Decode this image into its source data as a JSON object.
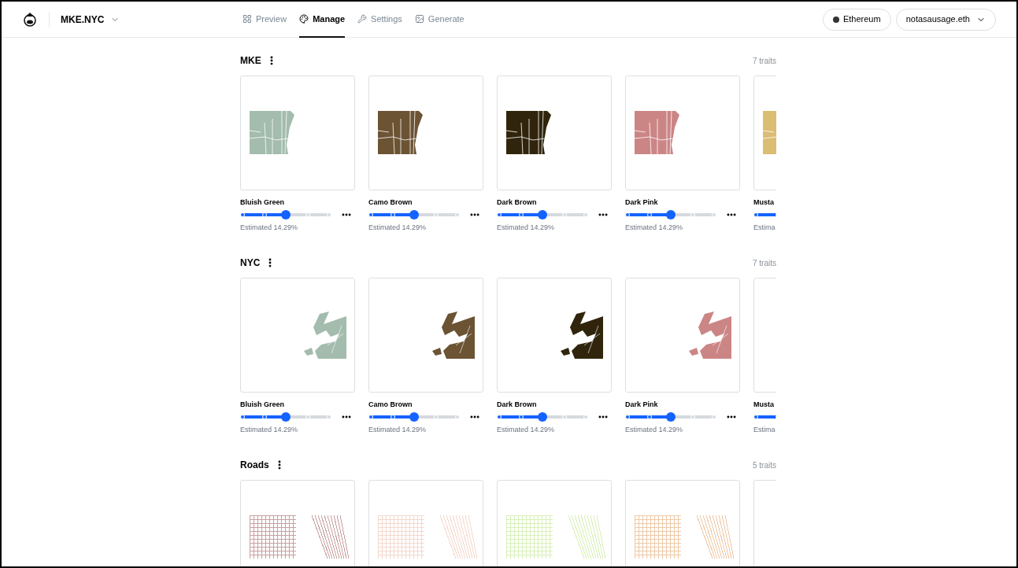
{
  "header": {
    "project": "MKE.NYC",
    "tabs": [
      {
        "label": "Preview",
        "selected": false
      },
      {
        "label": "Manage",
        "selected": true
      },
      {
        "label": "Settings",
        "selected": false
      },
      {
        "label": "Generate",
        "selected": false
      }
    ],
    "network": "Ethereum",
    "account": "notasausage.eth"
  },
  "sections": [
    {
      "title": "MKE",
      "count": "7 traits",
      "kind": "mke",
      "traits": [
        {
          "name": "Bluish Green",
          "color": "#a3bcad",
          "level": 0.5,
          "estimate": "Estimated 14.29%"
        },
        {
          "name": "Camo Brown",
          "color": "#6b5333",
          "level": 0.5,
          "estimate": "Estimated 14.29%"
        },
        {
          "name": "Dark Brown",
          "color": "#30250c",
          "level": 0.5,
          "estimate": "Estimated 14.29%"
        },
        {
          "name": "Dark Pink",
          "color": "#cc8585",
          "level": 0.5,
          "estimate": "Estimated 14.29%"
        },
        {
          "name": "Musta",
          "color": "#dbbd73",
          "level": 0.5,
          "estimate": "Estima"
        }
      ]
    },
    {
      "title": "NYC",
      "count": "7 traits",
      "kind": "nyc",
      "traits": [
        {
          "name": "Bluish Green",
          "color": "#a3bcad",
          "level": 0.5,
          "estimate": "Estimated 14.29%"
        },
        {
          "name": "Camo Brown",
          "color": "#6b5333",
          "level": 0.5,
          "estimate": "Estimated 14.29%"
        },
        {
          "name": "Dark Brown",
          "color": "#30250c",
          "level": 0.5,
          "estimate": "Estimated 14.29%"
        },
        {
          "name": "Dark Pink",
          "color": "#cc8585",
          "level": 0.5,
          "estimate": "Estimated 14.29%"
        },
        {
          "name": "Musta",
          "level": 0.5,
          "estimate": "Estima"
        }
      ]
    },
    {
      "title": "Roads",
      "count": "5 traits",
      "kind": "roads",
      "traits": [
        {
          "color": "#c8a0a0"
        },
        {
          "color": "#f3d8cc"
        },
        {
          "color": "#d8f0b8"
        },
        {
          "color": "#edc9a6"
        }
      ],
      "more_cut_off": true
    }
  ]
}
